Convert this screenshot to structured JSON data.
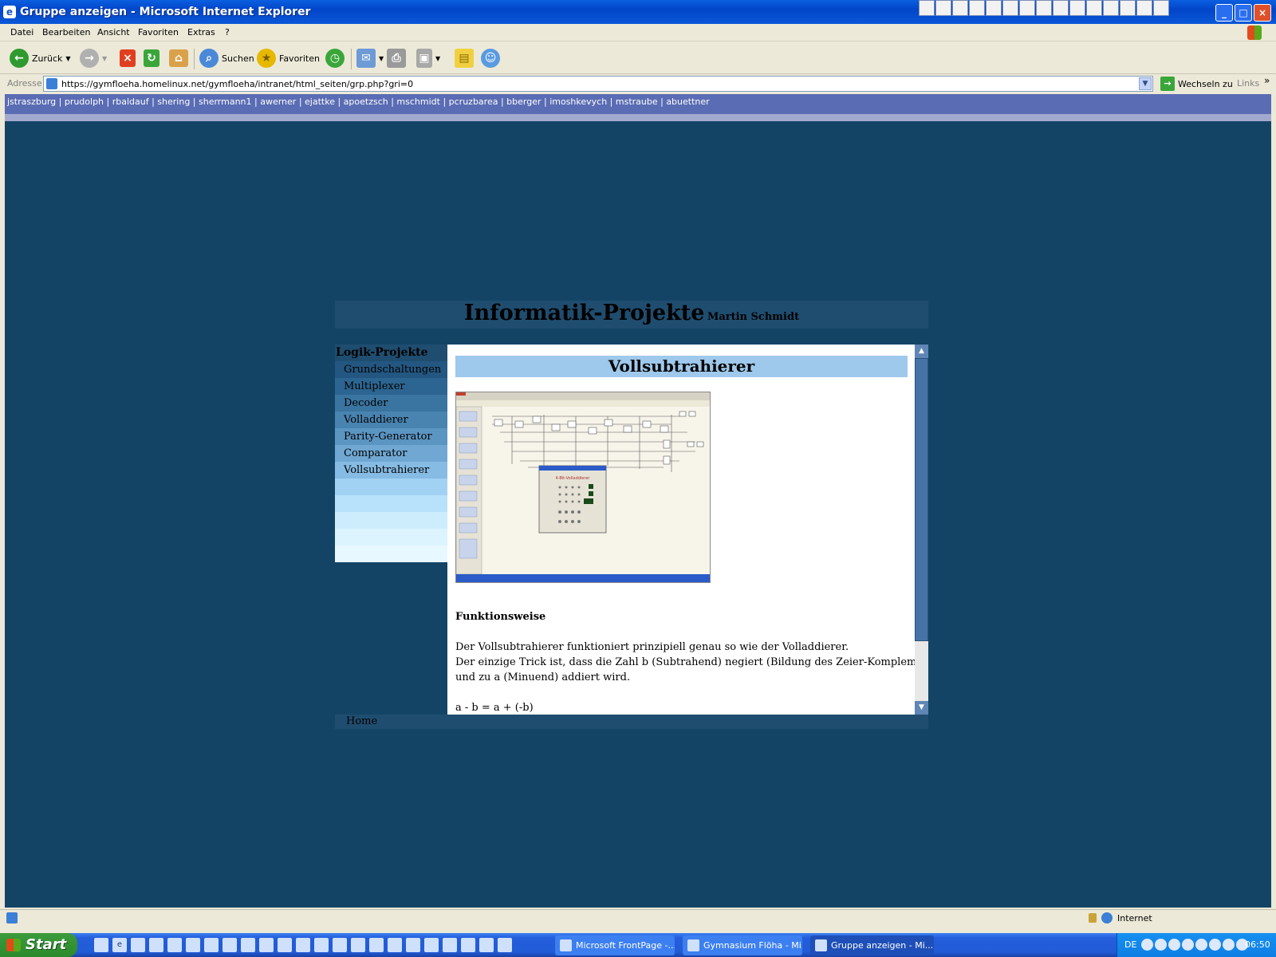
{
  "window": {
    "title": "Gruppe anzeigen - Microsoft Internet Explorer",
    "app_icon": "e"
  },
  "menu": [
    "Datei",
    "Bearbeiten",
    "Ansicht",
    "Favoriten",
    "Extras",
    "?"
  ],
  "toolbar": {
    "back_label": "Zurück",
    "search_label": "Suchen",
    "favorites_label": "Favoriten"
  },
  "address": {
    "label": "Adresse",
    "url": "https://gymfloeha.homelinux.net/gymfloeha/intranet/html_seiten/grp.php?gri=0",
    "go_label": "Wechseln zu",
    "links_label": "Links",
    "more": "»"
  },
  "page": {
    "users": "jstraszburg | prudolph | rbaldauf | shering | sherrmann1 | awerner | ejattke | apoetzsch | mschmidt | pcruzbarea | bberger | imoshkevych | mstraube | abuettner",
    "header_title": "Informatik-Projekte",
    "header_subtitle": "Martin Schmidt",
    "sidebar": {
      "heading": "Logik-Projekte",
      "items": [
        "Grundschaltungen",
        "Multiplexer",
        "Decoder",
        "Volladdierer",
        "Parity-Generator",
        "Comparator",
        "Vollsubtrahierer"
      ]
    },
    "content": {
      "title": "Vollsubtrahierer",
      "section": "Funktionsweise",
      "line1": "Der Vollsubtrahierer funktioniert prinzipiell genau so wie der Volladdierer.",
      "line2": "Der einzige Trick ist, dass die Zahl b (Subtrahend) negiert (Bildung des Zeier-Komplements)",
      "line3": "und zu a (Minuend) addiert wird.",
      "formula": "a - b = a + (-b)",
      "screenshot_caption": "4-Bit-Volladdierer"
    },
    "footer": "Home",
    "colors": {
      "page_bg": "#134466",
      "panel": "#1f4d6f",
      "title_bar": "#9ec9ec",
      "userbar": "#5a6cb4"
    }
  },
  "statusbar": {
    "zone": "Internet"
  },
  "taskbar": {
    "start_label": "Start",
    "tasks": [
      "Microsoft FrontPage -...",
      "Gymnasium Flöha - Mi...",
      "Gruppe anzeigen - Mi..."
    ],
    "lang": "DE",
    "clock": "06:50"
  }
}
